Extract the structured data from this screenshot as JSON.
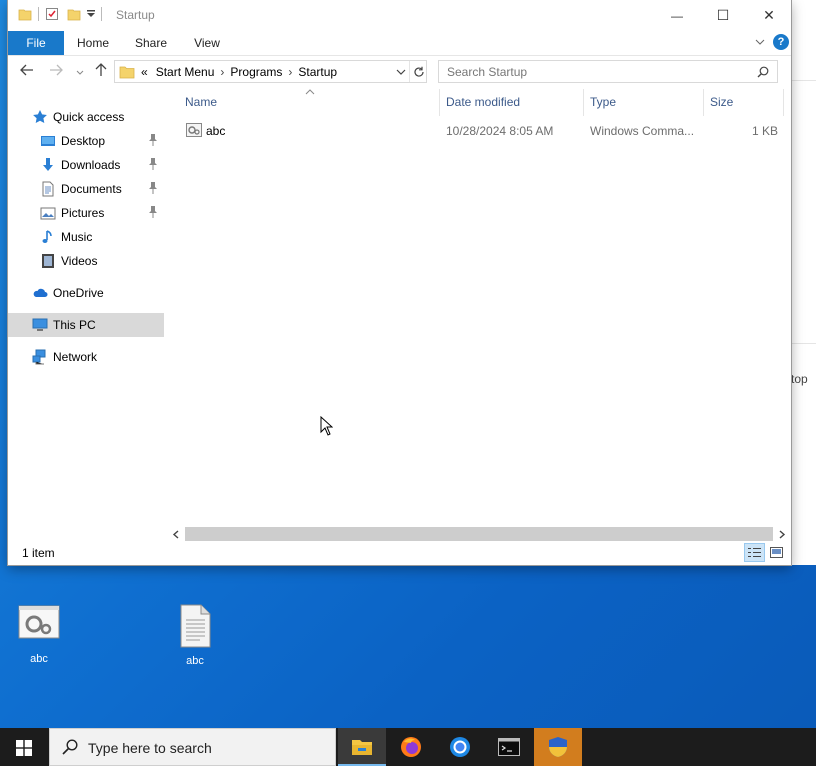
{
  "window": {
    "title": "Startup",
    "controls": {
      "minimize": "—",
      "maximize": "☐",
      "close": "✕"
    }
  },
  "ribbon": {
    "tabs": [
      "File",
      "Home",
      "Share",
      "View"
    ],
    "help_label": "?"
  },
  "address": {
    "overflow": "«",
    "crumbs": [
      "Start Menu",
      "Programs",
      "Startup"
    ],
    "separator": "›"
  },
  "search": {
    "placeholder": "Search Startup"
  },
  "sidebar": {
    "quick_access": "Quick access",
    "pinned": [
      {
        "label": "Desktop",
        "icon": "desktop-folder-icon",
        "pinned": true
      },
      {
        "label": "Downloads",
        "icon": "downloads-folder-icon",
        "pinned": true
      },
      {
        "label": "Documents",
        "icon": "documents-folder-icon",
        "pinned": true
      },
      {
        "label": "Pictures",
        "icon": "pictures-folder-icon",
        "pinned": true
      },
      {
        "label": "Music",
        "icon": "music-folder-icon",
        "pinned": false
      },
      {
        "label": "Videos",
        "icon": "videos-folder-icon",
        "pinned": false
      }
    ],
    "onedrive": "OneDrive",
    "this_pc": "This PC",
    "network": "Network"
  },
  "columns": [
    "Name",
    "Date modified",
    "Type",
    "Size"
  ],
  "files": [
    {
      "name": "abc",
      "date_modified": "10/28/2024 8:05 AM",
      "type": "Windows Comma...",
      "size": "1 KB"
    }
  ],
  "status": {
    "item_count": "1 item"
  },
  "background_window": {
    "partial_text": "top"
  },
  "desktop": {
    "icons": [
      {
        "label": "abc",
        "icon": "batch-file-icon"
      },
      {
        "label": "abc",
        "icon": "text-document-icon"
      }
    ]
  },
  "taskbar": {
    "search_placeholder": "Type here to search",
    "apps": [
      "file-explorer-icon",
      "firefox-icon",
      "chrome-icon",
      "terminal-icon",
      "security-shield-icon"
    ]
  },
  "colors": {
    "accent": "#1979ca",
    "selection": "#d9d9d9",
    "desktop": "#0f6fd0",
    "taskbar": "#1c1c1c"
  }
}
